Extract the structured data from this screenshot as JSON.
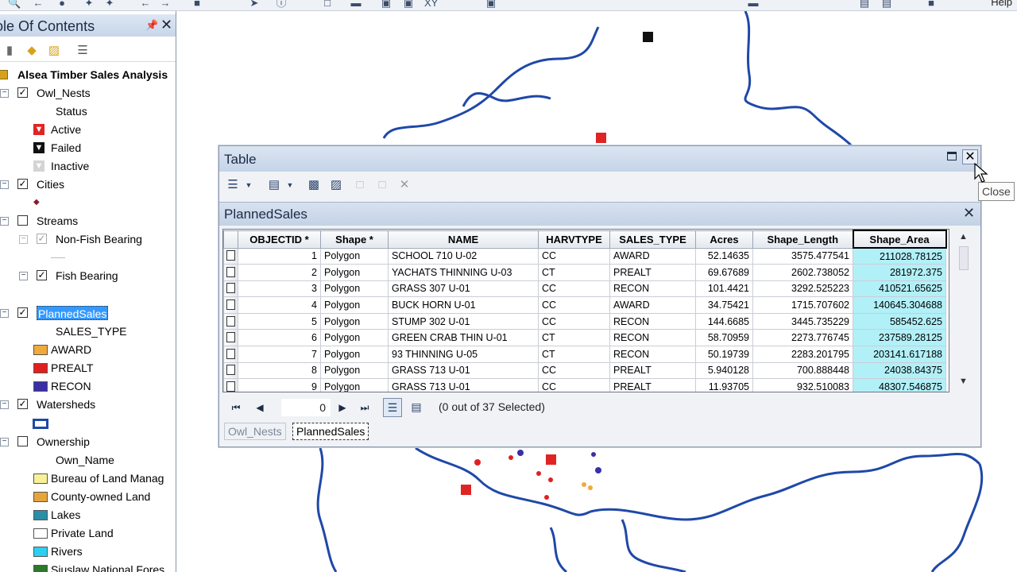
{
  "toolbar": {
    "help_label": "Help"
  },
  "toc": {
    "title": "ole Of Contents",
    "root_layer": "Alsea Timber Sales Analysis",
    "layers": [
      {
        "name": "Owl_Nests",
        "checked": true,
        "field": "Status",
        "classes": [
          {
            "label": "Active",
            "color": "#e02424"
          },
          {
            "label": "Failed",
            "color": "#111111"
          },
          {
            "label": "Inactive",
            "color": "#cfcfcf"
          }
        ]
      },
      {
        "name": "Cities",
        "checked": true
      },
      {
        "name": "Streams",
        "checked": false,
        "sublayers": [
          {
            "label": "Non-Fish Bearing",
            "checked": true
          },
          {
            "label": "Fish Bearing",
            "checked": true
          }
        ]
      },
      {
        "name": "PlannedSales",
        "checked": true,
        "field": "SALES_TYPE",
        "classes": [
          {
            "label": "AWARD",
            "color": "#f2a93b"
          },
          {
            "label": "PREALT",
            "color": "#e02020"
          },
          {
            "label": "RECON",
            "color": "#3a2fa6"
          }
        ]
      },
      {
        "name": "Watersheds",
        "checked": true
      },
      {
        "name": "Ownership",
        "checked": false,
        "field": "Own_Name",
        "classes": [
          {
            "label": "Bureau of Land Manag",
            "color": "#f7f19a"
          },
          {
            "label": "County-owned Land",
            "color": "#e6a53a"
          },
          {
            "label": "Lakes",
            "color": "#2a8ea6"
          },
          {
            "label": "Private Land",
            "color": "#ffffff"
          },
          {
            "label": "Rivers",
            "color": "#2ad0f2"
          },
          {
            "label": "Siuslaw National Fores",
            "color": "#2a7a2a"
          }
        ]
      }
    ]
  },
  "table_window": {
    "title": "Table",
    "table_name": "PlannedSales",
    "columns": [
      "OBJECTID *",
      "Shape *",
      "NAME",
      "HARVTYPE",
      "SALES_TYPE",
      "Acres",
      "Shape_Length",
      "Shape_Area"
    ],
    "rows": [
      [
        "1",
        "Polygon",
        "SCHOOL 710 U-02",
        "CC",
        "AWARD",
        "52.14635",
        "3575.477541",
        "211028.78125"
      ],
      [
        "2",
        "Polygon",
        "YACHATS THINNING U-03",
        "CT",
        "PREALT",
        "69.67689",
        "2602.738052",
        "281972.375"
      ],
      [
        "3",
        "Polygon",
        "GRASS 307 U-01",
        "CC",
        "RECON",
        "101.4421",
        "3292.525223",
        "410521.65625"
      ],
      [
        "4",
        "Polygon",
        "BUCK HORN U-01",
        "CC",
        "AWARD",
        "34.75421",
        "1715.707602",
        "140645.304688"
      ],
      [
        "5",
        "Polygon",
        "STUMP 302 U-01",
        "CC",
        "RECON",
        "144.6685",
        "3445.735229",
        "585452.625"
      ],
      [
        "6",
        "Polygon",
        "GREEN CRAB THIN U-01",
        "CT",
        "RECON",
        "58.70959",
        "2273.776745",
        "237589.28125"
      ],
      [
        "7",
        "Polygon",
        "93 THINNING U-05",
        "CT",
        "RECON",
        "50.19739",
        "2283.201795",
        "203141.617188"
      ],
      [
        "8",
        "Polygon",
        "GRASS 713 U-01",
        "CC",
        "PREALT",
        "5.940128",
        "700.888448",
        "24038.84375"
      ],
      [
        "9",
        "Polygon",
        "GRASS 713 U-01",
        "CC",
        "PREALT",
        "11.93705",
        "932.510083",
        "48307.546875"
      ]
    ],
    "record_number": "0",
    "selection_status": "(0 out of 37 Selected)",
    "tabs": [
      "Owl_Nests",
      "PlannedSales"
    ],
    "active_tab": "PlannedSales",
    "close_tooltip": "Close"
  },
  "colors": {
    "selected_column": "#b2f0f8",
    "watershed_line": "#1f48a8",
    "titlebar": "#c8d6ea"
  }
}
